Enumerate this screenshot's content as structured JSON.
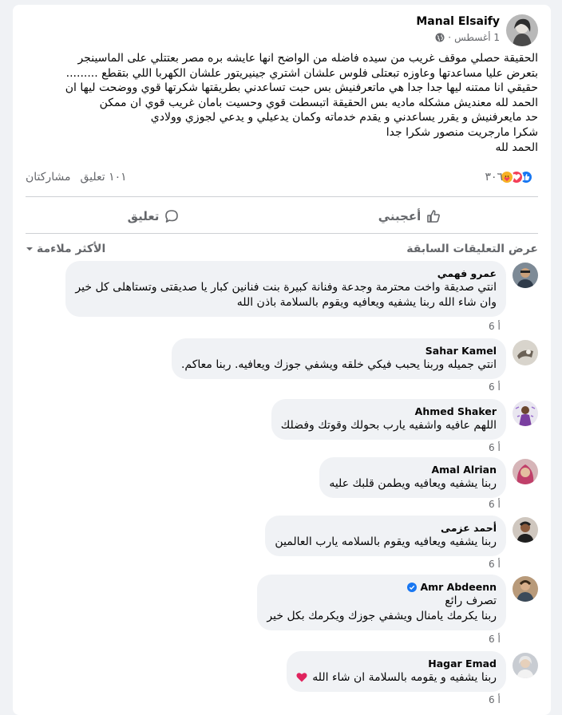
{
  "post": {
    "author": "Manal Elsaify",
    "date": "1 أغسطس",
    "separator": "·",
    "lines": [
      "الحقيقة حصلي موقف غريب  من سيده فاضله من الواضح انها عايشه بره مصر بعتتلي على الماسينجر",
      "بتعرض عليا مساعدتها وعاوزه تبعتلى فلوس علشان اشتري جينيريتور علشان الكهربا  اللي بتقطع .........",
      "حقيقي انا ممتنه ليها جدا جدا هي ماتعرفنيش بس حبت تساعدني بطريقتها شكرتها قوي ووضحت ليها ان",
      "الحمد لله معنديش مشكله ماديه بس الحقيقة اتبسطت قوي وحسيت بامان غريب قوي ان ممكن",
      "حد مايعرفنيش  و يقرر يساعدني و يقدم خدماته وكمان يدعيلي و يدعي لجوزي وولادي",
      "شكرا مارجريت منصور شكرا جدا",
      "الحمد لله"
    ],
    "reactions_count": "٣٠٦",
    "comments_count": "١٠١ تعليق",
    "shares": "مشاركتان"
  },
  "actions": {
    "like": "أعجبني",
    "comment": "تعليق"
  },
  "comments_header": {
    "previous": "عرض التعليقات السابقة",
    "relevance": "الأكثر ملاءمة"
  },
  "comments": [
    {
      "name": "عمرو فهمي",
      "lines": [
        "انتي صديقة واخت محترمة وجدعة وفنانة كبيرة بنت فنانين كبار يا صديقتى وتستاهلى كل خير",
        "وان شاء الله ربنا يشفيه ويعافيه ويقوم بالسلامة باذن الله"
      ],
      "time": "6 أ"
    },
    {
      "name": "Sahar Kamel",
      "lines": [
        "انتي جميله وربنا يحبب فيكي خلقه ويشفي جوزك ويعافيه. ربنا معاكم."
      ],
      "time": "6 أ"
    },
    {
      "name": "Ahmed Shaker",
      "lines": [
        "اللهم عافيه واشفيه يارب بحولك وقوتك وفضلك"
      ],
      "time": "6 أ"
    },
    {
      "name": "Amal Alrian",
      "lines": [
        "ربنا يشفيه ويعافيه ويطمن قلبك عليه"
      ],
      "time": "6 أ"
    },
    {
      "name": "أحمد عزمى",
      "lines": [
        "ربنا يشفيه ويعافيه ويقوم بالسلامه يارب العالمين"
      ],
      "time": "6 أ"
    },
    {
      "name": "Amr Abdeenn",
      "lines": [
        "تصرف رائع",
        "ربنا يكرمك يامنال ويشفي جوزك ويكرمك بكل خير"
      ],
      "time": "6 أ"
    },
    {
      "name": "Hagar Emad",
      "lines": [
        "ربنا يشفيه و يقومه بالسلامة ان شاء الله"
      ],
      "time": "6 أ"
    }
  ],
  "colors": {
    "like_blue": "#1877f2",
    "love_red": "#f33e58",
    "care_yellow": "#f7b125",
    "muted": "#65676b"
  }
}
